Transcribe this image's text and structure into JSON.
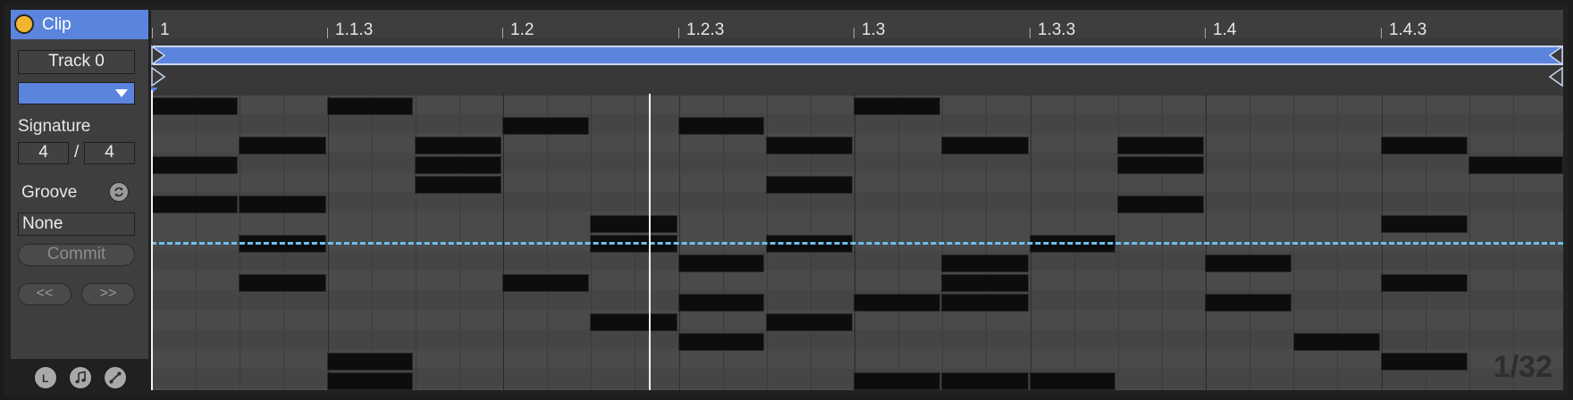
{
  "clip": {
    "title": "Clip",
    "track_name": "Track 0",
    "color": "#5b84dd",
    "signature_label": "Signature",
    "signature_numerator": "4",
    "signature_slash": "/",
    "signature_denominator": "4",
    "groove_label": "Groove",
    "groove_value": "None",
    "commit_label": "Commit",
    "prev_label": "<<",
    "next_label": ">>"
  },
  "bottom_icons": [
    "loop-icon",
    "note-icon",
    "envelope-icon"
  ],
  "bottom_icon_letters": [
    "L"
  ],
  "ruler_labels": [
    "1",
    "1.1.3",
    "1.2",
    "1.2.3",
    "1.3",
    "1.3.3",
    "1.4",
    "1.4.3"
  ],
  "grid_readout": "1/32",
  "colors": {
    "accent": "#5b84dd",
    "clip_dot": "#f3b42f",
    "pitch_guide": "#6fc1ea"
  }
}
